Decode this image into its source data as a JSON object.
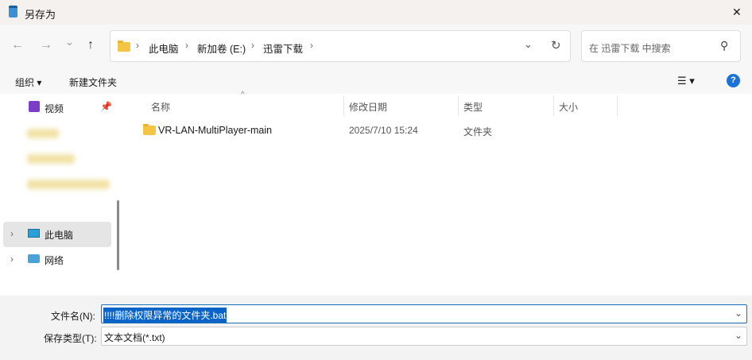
{
  "window": {
    "title": "另存为",
    "close": "✕"
  },
  "nav": {
    "back": "←",
    "forward": "→",
    "recent": "⌄",
    "up": "↑",
    "refresh": "↻",
    "dropdown": "⌄"
  },
  "breadcrumb": [
    "此电脑",
    "新加卷 (E:)",
    "迅雷下载"
  ],
  "search": {
    "placeholder": "在 迅雷下载 中搜索"
  },
  "toolbar": {
    "organize": "组织 ▾",
    "new_folder": "新建文件夹",
    "view": "☰ ▾",
    "help": "?"
  },
  "sidebar": {
    "items": [
      {
        "label": "视频"
      },
      {
        "label": "此电脑"
      },
      {
        "label": "网络"
      }
    ]
  },
  "columns": {
    "name": "名称",
    "modified": "修改日期",
    "type": "类型",
    "size": "大小"
  },
  "files": [
    {
      "name": "VR-LAN-MultiPlayer-main",
      "modified": "2025/7/10 15:24",
      "type": "文件夹",
      "size": ""
    }
  ],
  "bottom": {
    "filename_label": "文件名(N):",
    "filename_value": "!!!!删除权限异常的文件夹.bat",
    "type_label": "保存类型(T):",
    "type_value": "文本文档(*.txt)"
  }
}
